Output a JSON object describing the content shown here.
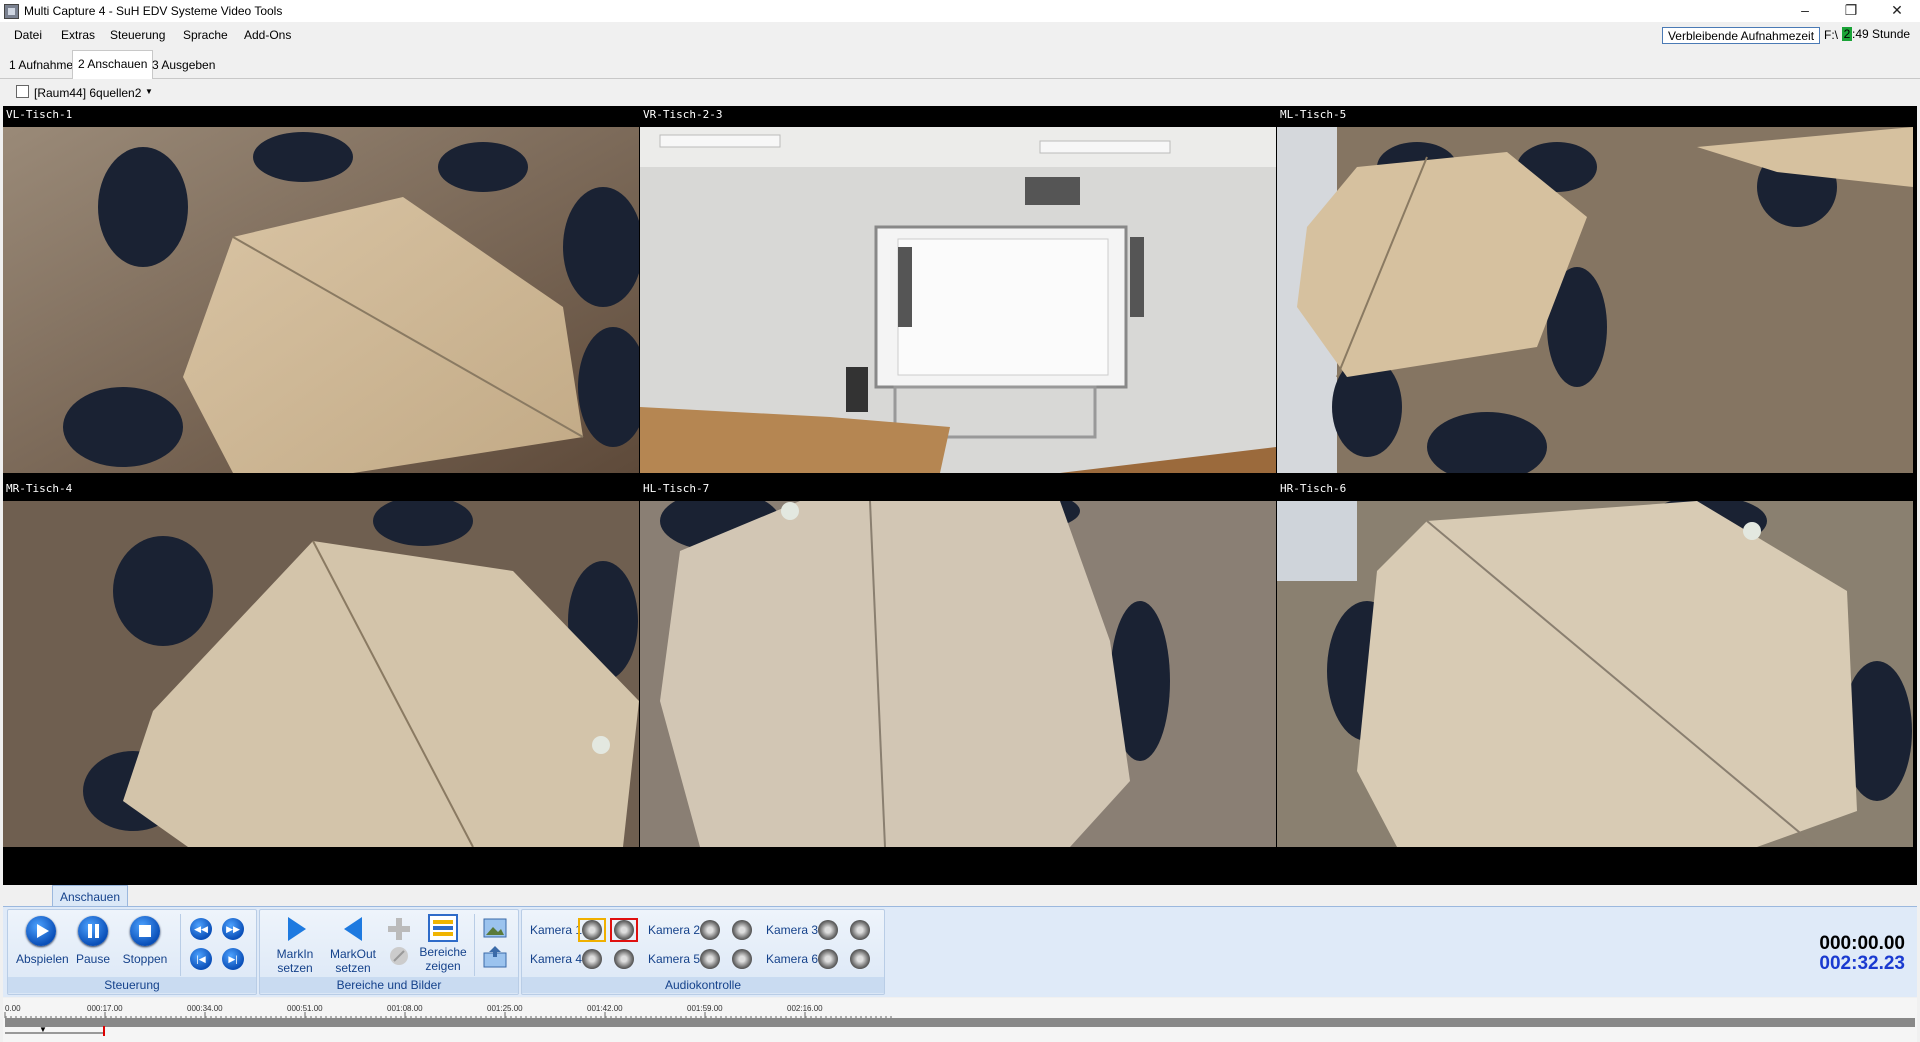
{
  "window": {
    "title": "Multi Capture 4 - SuH EDV Systeme Video Tools",
    "minimize": "–",
    "restore": "❐",
    "close": "✕"
  },
  "menu": [
    "Datei",
    "Extras",
    "Steuerung",
    "Sprache",
    "Add-Ons"
  ],
  "status": {
    "remaining_label": "Verbleibende Aufnahmezeit",
    "drive": "F:\\",
    "time_digit": "2",
    "time_rest": ":49 Stunde"
  },
  "tabs": [
    "1 Aufnahme",
    "2 Anschauen",
    "3 Ausgeben"
  ],
  "toolbar": {
    "config": "[Raum44] 6quellen2"
  },
  "cameras": [
    "VL-Tisch-1",
    "VR-Tisch-2-3",
    "ML-Tisch-5",
    "MR-Tisch-4",
    "HL-Tisch-7",
    "HR-Tisch-6"
  ],
  "ribbon": {
    "tab": "Anschauen",
    "steuerung": {
      "title": "Steuerung",
      "play": "Abspielen",
      "pause": "Pause",
      "stop": "Stoppen"
    },
    "bereiche": {
      "title": "Bereiche und Bilder",
      "markin_1": "MarkIn",
      "markin_2": "setzen",
      "markout_1": "MarkOut",
      "markout_2": "setzen",
      "show_1": "Bereiche",
      "show_2": "zeigen"
    },
    "audio": {
      "title": "Audiokontrolle",
      "cams": [
        "Kamera 1",
        "Kamera 2",
        "Kamera 3",
        "Kamera 4",
        "Kamera 5",
        "Kamera 6"
      ]
    }
  },
  "counter": {
    "current": "000:00.00",
    "total": "002:32.23"
  },
  "timeline": {
    "ticks": [
      "0.00",
      "000:17.00",
      "000:34.00",
      "000:51.00",
      "001:08.00",
      "001:25.00",
      "001:42.00",
      "001:59.00",
      "002:16.00"
    ]
  },
  "colors": {
    "accent": "#15428b",
    "total_time": "#1a3ad0",
    "record_highlight": "#e01010"
  }
}
